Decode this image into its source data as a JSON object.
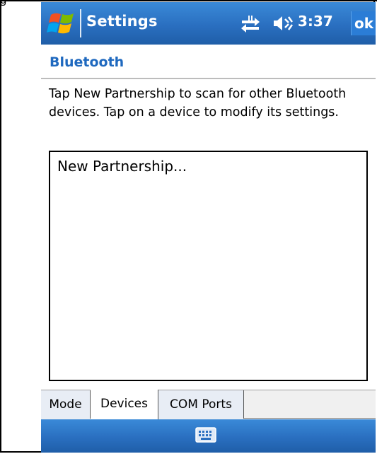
{
  "document": {
    "caption_fragment": "g"
  },
  "titlebar": {
    "title": "Settings",
    "clock": "3:37",
    "ok_label": "ok",
    "start_icon": "windows-flag-icon",
    "connectivity_icon": "connectivity-arrows-icon",
    "volume_icon": "speaker-icon"
  },
  "page": {
    "subtitle": "Bluetooth",
    "instructions": "Tap New Partnership to scan for other Bluetooth devices. Tap on a device to modify its settings."
  },
  "device_list": {
    "items": [
      "New Partnership..."
    ]
  },
  "tabs": [
    {
      "label": "Mode",
      "selected": false
    },
    {
      "label": "Devices",
      "selected": true
    },
    {
      "label": "COM Ports",
      "selected": false
    }
  ],
  "menubar": {
    "input_icon": "keyboard-icon"
  },
  "colors": {
    "bar_blue": "#2a6fc0",
    "subtitle_blue": "#1f69bf"
  }
}
